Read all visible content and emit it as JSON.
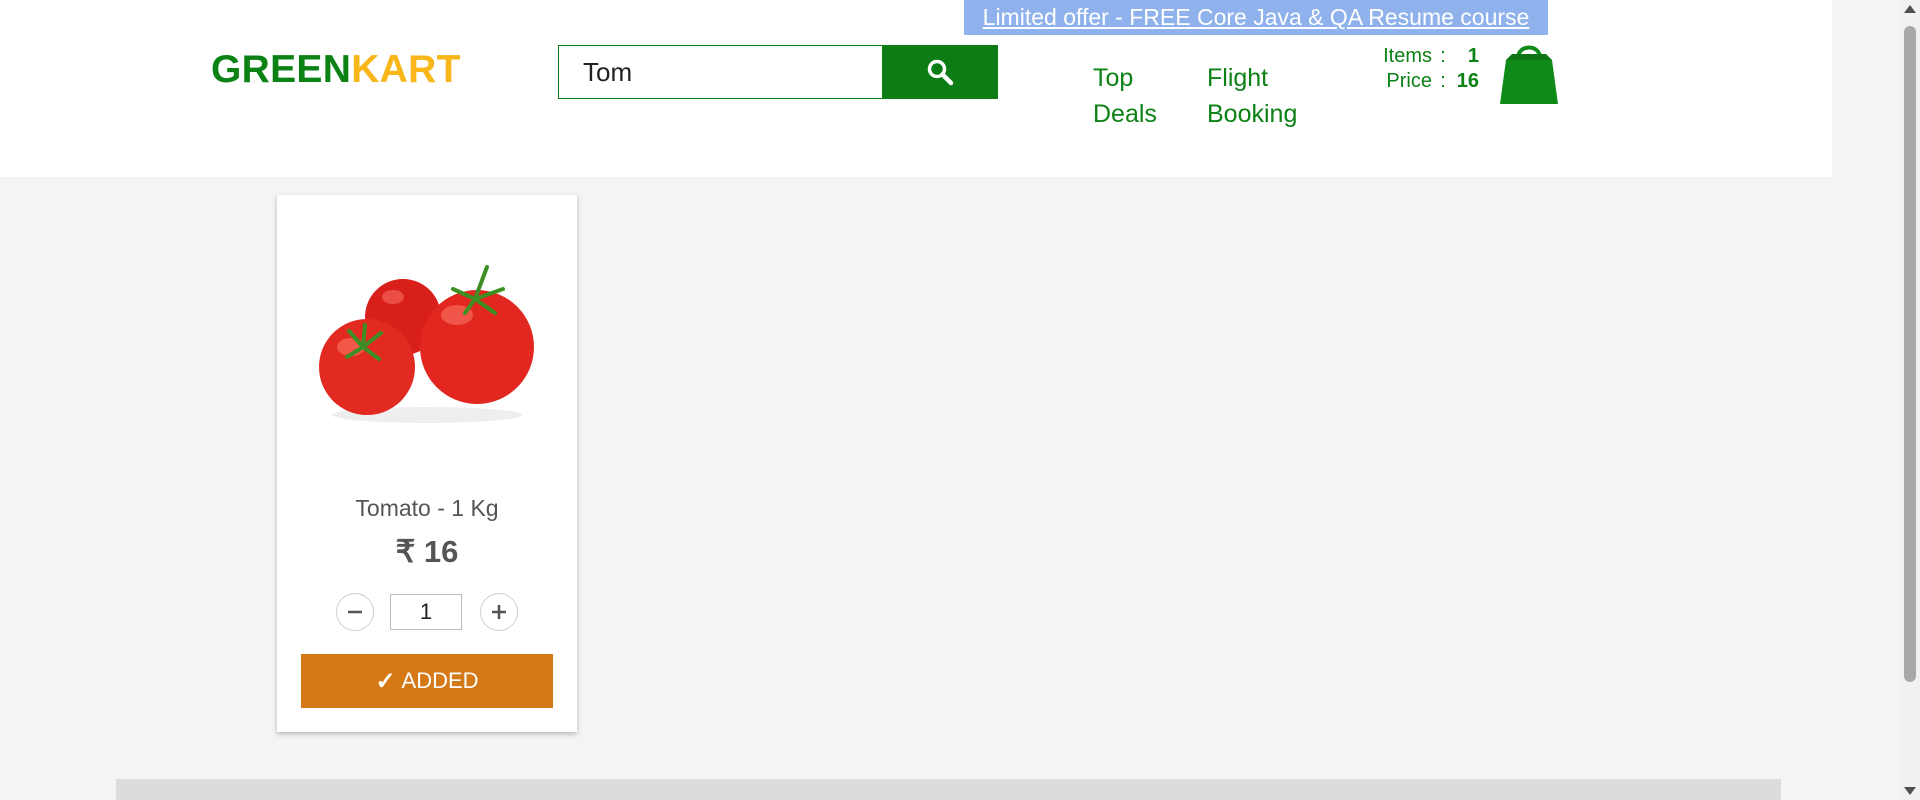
{
  "header": {
    "promo": "Limited offer - FREE Core Java & QA Resume course",
    "brand": {
      "green": "GREEN",
      "kart": "KART"
    },
    "search": {
      "value": "Tom",
      "icon": "search-icon"
    },
    "nav": {
      "top_deals": "Top Deals",
      "flight_booking": "Flight Booking"
    },
    "cart": {
      "items_label": "Items",
      "items_value": "1",
      "price_label": "Price",
      "price_value": "16",
      "separator": ":",
      "icon": "shopping-bag-icon"
    }
  },
  "product": {
    "name": "Tomato - 1 Kg",
    "price": "₹ 16",
    "quantity": "1",
    "added_label": "ADDED",
    "check": "✓",
    "image": "tomato-image"
  },
  "colors": {
    "brand_green": "#0c8215",
    "brand_orange": "#f8b619",
    "added_button": "#d57816",
    "promo_bg": "#8fb2ec"
  }
}
